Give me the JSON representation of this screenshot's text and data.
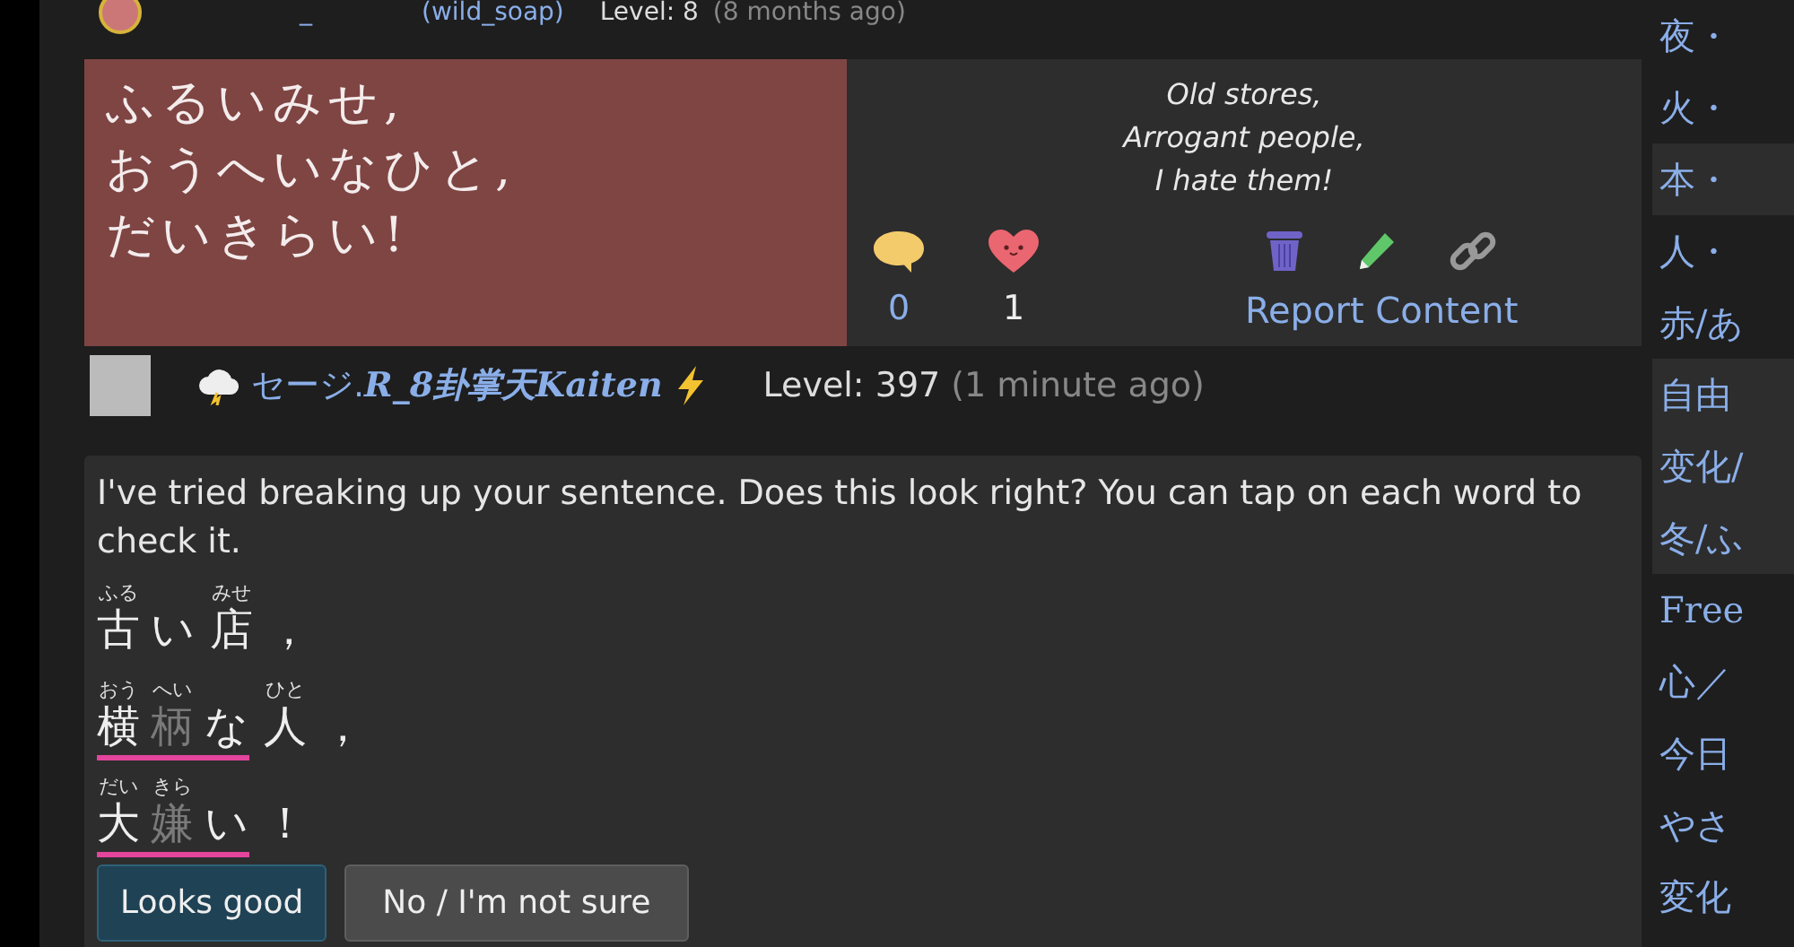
{
  "previous_post": {
    "username": "_",
    "handle": "(wild_soap)",
    "level": "Level: 8",
    "time": "(8 months ago)"
  },
  "sentence_card": {
    "japanese_lines": [
      "ふるいみせ,",
      "おうへいなひと,",
      "だいきらい!"
    ],
    "translation_lines": [
      "Old stores,",
      "Arrogant people,",
      "I hate them!"
    ],
    "comment_count": "0",
    "like_count": "1",
    "like_active": true,
    "report_label": "Report Content"
  },
  "reply_author": {
    "name_prefix": "セージ.",
    "name_stylized": "R_8卦掌天Kaiten",
    "level": "Level: 397",
    "time": "(1 minute ago)"
  },
  "breakdown": {
    "message": "I've tried breaking up your sentence. Does this look right? You can tap on each word to check it.",
    "lines": [
      {
        "words": [
          {
            "underlined": false,
            "parts": [
              {
                "text": "古",
                "reading": "ふる",
                "dim": false
              },
              {
                "text": "い",
                "dim": false
              }
            ]
          },
          {
            "underlined": false,
            "parts": [
              {
                "text": "店",
                "reading": "みせ",
                "dim": false
              }
            ]
          },
          {
            "underlined": false,
            "parts": [
              {
                "text": "，",
                "dim": false
              }
            ]
          }
        ]
      },
      {
        "words": [
          {
            "underlined": true,
            "parts": [
              {
                "text": "横",
                "reading": "おう",
                "dim": false
              },
              {
                "text": "柄",
                "reading": "へい",
                "dim": true
              },
              {
                "text": "な",
                "dim": false
              }
            ]
          },
          {
            "underlined": false,
            "parts": [
              {
                "text": "人",
                "reading": "ひと",
                "dim": false
              }
            ]
          },
          {
            "underlined": false,
            "parts": [
              {
                "text": "，",
                "dim": false
              }
            ]
          }
        ]
      },
      {
        "words": [
          {
            "underlined": true,
            "parts": [
              {
                "text": "大",
                "reading": "だい",
                "dim": false
              },
              {
                "text": "嫌",
                "reading": "きら",
                "dim": true
              },
              {
                "text": "い",
                "dim": false
              }
            ]
          },
          {
            "underlined": false,
            "parts": [
              {
                "text": "！",
                "dim": false
              }
            ]
          }
        ]
      }
    ],
    "buttons": [
      {
        "label": "Looks good",
        "kind": "primary"
      },
      {
        "label": "No / I'm not sure",
        "kind": "secondary"
      }
    ]
  },
  "sidebar": {
    "items": [
      {
        "label": "夜・",
        "highlighted": false
      },
      {
        "label": "火・",
        "highlighted": false
      },
      {
        "label": "本・",
        "highlighted": true
      },
      {
        "label": "人・",
        "highlighted": false
      },
      {
        "label": "赤/あ",
        "highlighted": false
      },
      {
        "label": "自由",
        "highlighted": true
      },
      {
        "label": "变化/",
        "highlighted": true
      },
      {
        "label": "冬/ふ",
        "highlighted": true
      },
      {
        "label": "Free",
        "highlighted": false
      },
      {
        "label": "心／",
        "highlighted": false
      },
      {
        "label": "今日",
        "highlighted": false
      },
      {
        "label": "やさ",
        "highlighted": false
      },
      {
        "label": "変化",
        "highlighted": false
      }
    ]
  }
}
